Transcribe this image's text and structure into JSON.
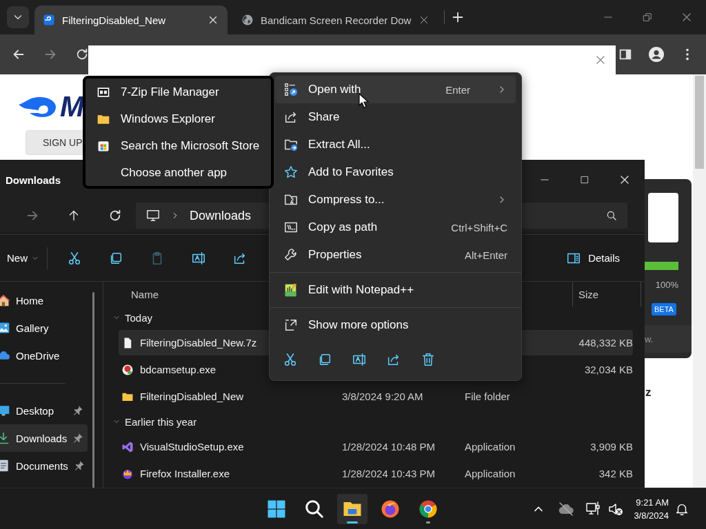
{
  "browser": {
    "tabs": [
      {
        "title": "FilteringDisabled_New",
        "kind": "site",
        "selected": true
      },
      {
        "title": "Bandicam Screen Recorder Dow",
        "kind": "globe",
        "selected": false
      }
    ],
    "nav": [
      {
        "kind": "back",
        "disabled": false
      },
      {
        "kind": "forward",
        "disabled": true
      },
      {
        "kind": "reload",
        "disabled": false
      }
    ]
  },
  "site": {
    "logo_text": "M",
    "signup": "SIGN UP",
    "progress": {
      "reading": "100%"
    },
    "badge": "BETA",
    "row_text": "w.",
    "side_text": "z"
  },
  "explorer": {
    "title": "Downloads",
    "nav": [
      {
        "kind": "forward",
        "disabled": true
      },
      {
        "kind": "up",
        "disabled": false
      },
      {
        "kind": "refresh",
        "disabled": false
      }
    ],
    "path": [
      "Downloads"
    ],
    "new_label": "New",
    "actions": [
      {
        "kind": "cut",
        "disabled": false
      },
      {
        "kind": "copy",
        "disabled": false
      },
      {
        "kind": "paste",
        "disabled": true
      },
      {
        "kind": "rename",
        "disabled": false
      },
      {
        "kind": "share",
        "disabled": false
      }
    ],
    "details_label": "Details",
    "sidebar": [
      {
        "label": "Home",
        "kind": "home",
        "pinned": false,
        "selected": false
      },
      {
        "label": "Gallery",
        "kind": "gallery",
        "pinned": false,
        "selected": false
      },
      {
        "label": "OneDrive",
        "kind": "cloud",
        "pinned": false,
        "selected": false
      },
      {
        "kind": "divider"
      },
      {
        "label": "Desktop",
        "kind": "desktop",
        "pinned": true,
        "selected": false
      },
      {
        "label": "Downloads",
        "kind": "downloads",
        "pinned": true,
        "selected": true
      },
      {
        "label": "Documents",
        "kind": "documents",
        "pinned": true,
        "selected": false
      }
    ],
    "columns": {
      "name": "Name",
      "size": "Size"
    },
    "groups": [
      {
        "label": "Today",
        "expanded": true,
        "files": [
          {
            "name": "FilteringDisabled_New.7z",
            "kind": "document",
            "size": "448,332 KB",
            "selected": true
          },
          {
            "name": "bdcamsetup.exe",
            "kind": "recorder",
            "size": "32,034 KB",
            "selected": false
          },
          {
            "name": "FilteringDisabled_New",
            "kind": "folder",
            "date": "3/8/2024 9:20 AM",
            "type": "File folder",
            "selected": false
          }
        ]
      },
      {
        "label": "Earlier this year",
        "expanded": true,
        "files": [
          {
            "name": "VisualStudioSetup.exe",
            "kind": "ribbon",
            "date": "1/28/2024 10:48 PM",
            "type": "Application",
            "size": "3,909 KB",
            "selected": false
          },
          {
            "name": "Firefox Installer.exe",
            "kind": "installer",
            "date": "1/28/2024 10:43 PM",
            "type": "Application",
            "size": "342 KB",
            "selected": false
          }
        ]
      }
    ]
  },
  "context_menu": {
    "sections": [
      [
        {
          "label": "Open with",
          "kind": "open-with",
          "shortcut": "Enter",
          "submenu": true,
          "highlighted": true
        },
        {
          "label": "Share",
          "kind": "share",
          "submenu": false,
          "highlighted": false
        },
        {
          "label": "Extract All...",
          "kind": "extract",
          "submenu": false,
          "highlighted": false
        },
        {
          "label": "Add to Favorites",
          "kind": "star",
          "submenu": false,
          "highlighted": false
        },
        {
          "label": "Compress to...",
          "kind": "compress",
          "submenu": true,
          "highlighted": false
        },
        {
          "label": "Copy as path",
          "kind": "copy-path",
          "shortcut": "Ctrl+Shift+C",
          "submenu": false,
          "highlighted": false
        },
        {
          "label": "Properties",
          "kind": "wrench",
          "shortcut": "Alt+Enter",
          "submenu": false,
          "highlighted": false
        }
      ],
      [
        {
          "label": "Edit with Notepad++",
          "kind": "notepad",
          "submenu": false,
          "highlighted": false
        }
      ],
      [
        {
          "label": "Show more options",
          "kind": "show-more",
          "submenu": false,
          "highlighted": false
        }
      ]
    ]
  },
  "submenu": {
    "items": [
      {
        "label": "7-Zip File Manager",
        "kind": "archiver"
      },
      {
        "label": "Windows Explorer",
        "kind": "folder"
      },
      {
        "label": "Search the Microsoft Store",
        "kind": "store"
      },
      {
        "label": "Choose another app",
        "kind": "none"
      }
    ]
  },
  "taskbar": {
    "apps": [
      {
        "kind": "start",
        "active": false,
        "running": false
      },
      {
        "kind": "search",
        "active": false,
        "running": false
      },
      {
        "kind": "explorer",
        "active": true,
        "running": true
      },
      {
        "kind": "firefox",
        "active": false,
        "running": false
      },
      {
        "kind": "chrome",
        "active": false,
        "running": true
      }
    ],
    "time": "9:21 AM",
    "date": "3/8/2024"
  }
}
